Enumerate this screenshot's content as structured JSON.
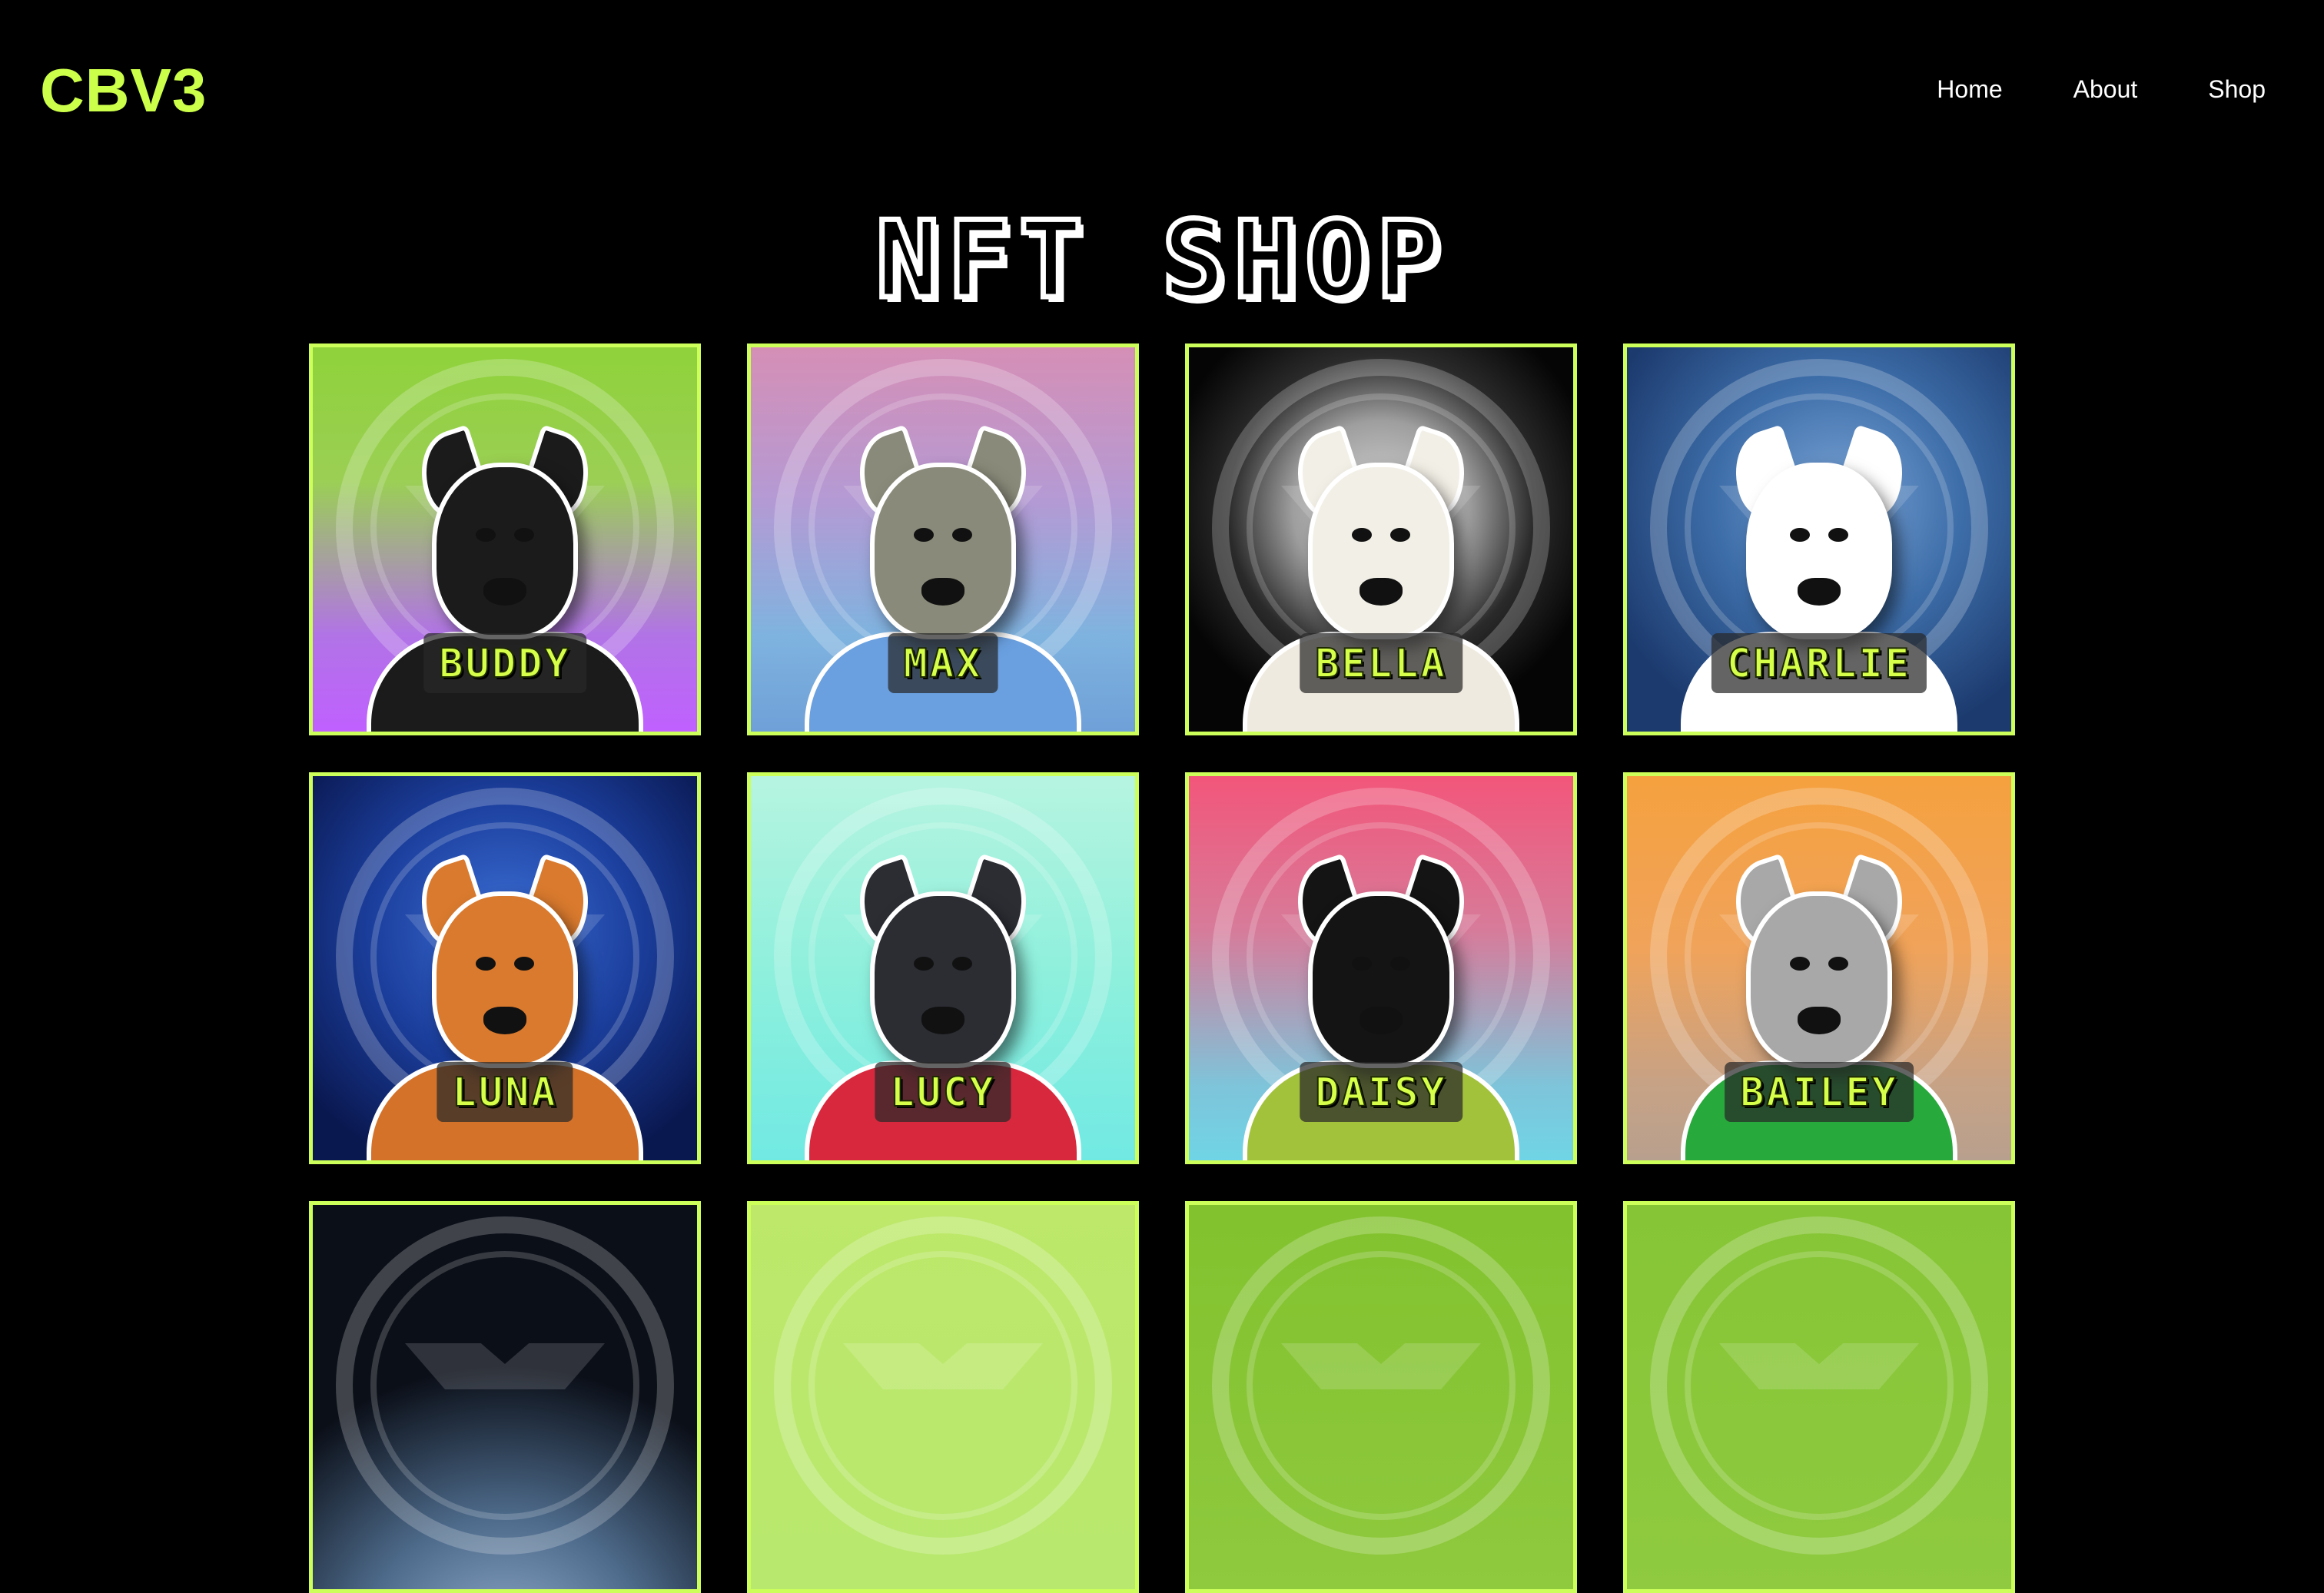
{
  "header": {
    "logo": "CBV3",
    "nav": [
      {
        "label": "Home"
      },
      {
        "label": "About"
      },
      {
        "label": "Shop"
      }
    ]
  },
  "main": {
    "title": "NFT SHOP",
    "cards": [
      {
        "name": "BUDDY",
        "bg": "linear-gradient(180deg,#8fd23a 0%,#9bcf55 35%,#b173e6 75%,#c060ff 100%)",
        "head": "#1b1b1b",
        "body": "#1b1b1b"
      },
      {
        "name": "MAX",
        "bg": "linear-gradient(180deg,#d58fb6 0%,#b49ad4 40%,#7fb3df 75%,#6fa0d8 100%)",
        "head": "#8a8a7a",
        "body": "#6aa0e0"
      },
      {
        "name": "BELLA",
        "bg": "radial-gradient(circle at 50% 42%,#d9d9d9 0%,#9e9e9e 30%,#2a2a2a 52%,#050505 75%)",
        "head": "#f2efe6",
        "body": "#efeadf"
      },
      {
        "name": "CHARLIE",
        "bg": "radial-gradient(circle at 55% 40%,#7aa4d6 0%,#3d6da8 40%,#1c3a6e 80%)",
        "head": "#ffffff",
        "body": "#ffffff"
      },
      {
        "name": "LUNA",
        "bg": "radial-gradient(circle at 50% 40%,#3c6fd6 0%,#1b3e9c 45%,#0a1850 85%)",
        "head": "#d97a2e",
        "body": "#d4722a"
      },
      {
        "name": "LUCY",
        "bg": "linear-gradient(180deg,#b6f4e0 0%,#8ff0dc 50%,#71e9e3 100%)",
        "head": "#2b2d33",
        "body": "#d8283e"
      },
      {
        "name": "DAISY",
        "bg": "linear-gradient(180deg,#f2567a 0%,#d77b9a 40%,#7fc3d9 80%,#6fd5e6 100%)",
        "head": "#141414",
        "body": "#a3c23c"
      },
      {
        "name": "BAILEY",
        "bg": "linear-gradient(180deg,#f5a13f 0%,#f0a35a 45%,#c7a285 80%,#b8a08e 100%)",
        "head": "#a8a8a8",
        "body": "#27a93c"
      },
      {
        "name": "",
        "bg": "radial-gradient(circle at 50% 120%,#9ab4d6 0%,#4d6a8a 30%,#0b0f18 60%)",
        "head": "",
        "body": ""
      },
      {
        "name": "",
        "bg": "linear-gradient(180deg,#bde86a 0%,#b8e86e 100%)",
        "head": "",
        "body": ""
      },
      {
        "name": "",
        "bg": "linear-gradient(180deg,#82c22e 0%,#8fc93e 100%)",
        "head": "",
        "body": ""
      },
      {
        "name": "",
        "bg": "linear-gradient(180deg,#86c535 0%,#8fca40 100%)",
        "head": "",
        "body": ""
      }
    ]
  }
}
